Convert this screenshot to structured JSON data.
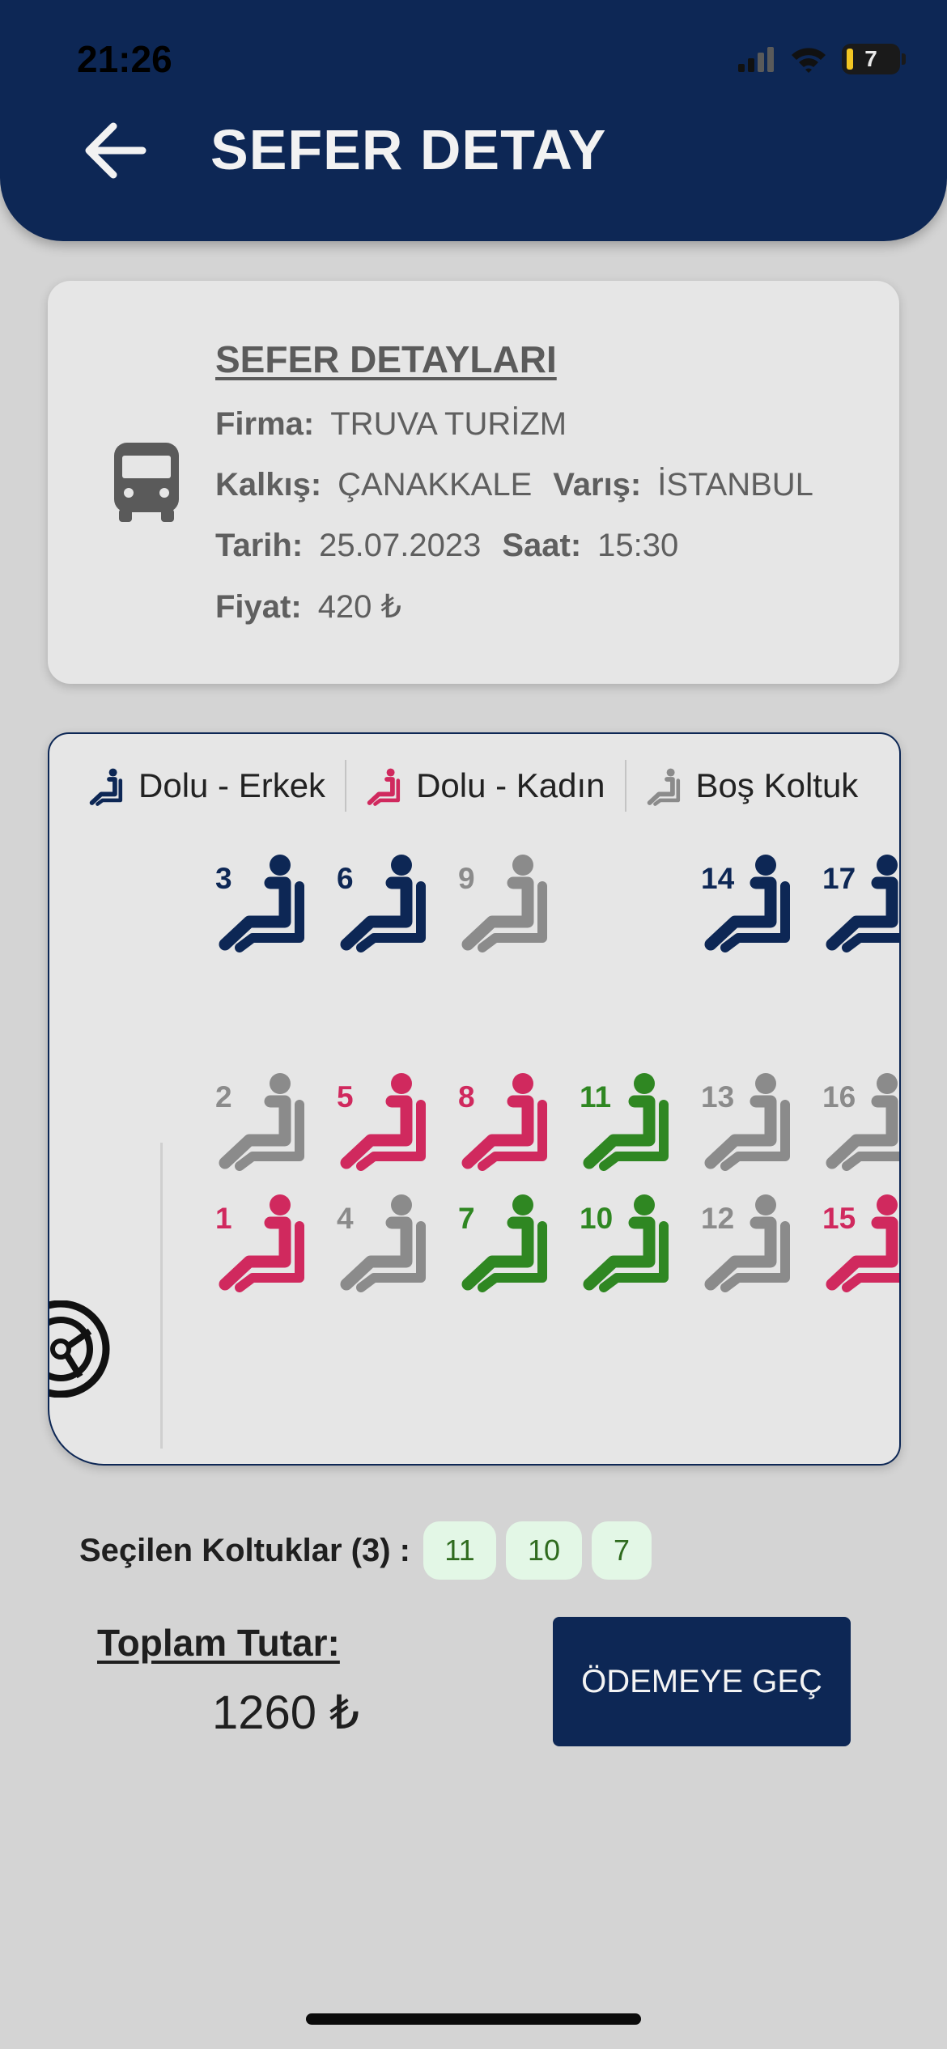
{
  "status_bar": {
    "time": "21:26",
    "battery": "7",
    "icons": [
      "cellular-signal-icon",
      "wifi-icon",
      "battery-icon"
    ]
  },
  "header": {
    "title": "SEFER DETAY",
    "back_icon": "arrow-left-icon"
  },
  "trip": {
    "heading": "SEFER DETAYLARI",
    "icon": "bus-icon",
    "company_label": "Firma:",
    "company": "TRUVA TURİZM",
    "from_label": "Kalkış:",
    "from": "ÇANAKKALE",
    "to_label": "Varış:",
    "to": "İSTANBUL",
    "date_label": "Tarih:",
    "date": "25.07.2023",
    "time_label": "Saat:",
    "time": "15:30",
    "price_label": "Fiyat:",
    "price": "420 ₺"
  },
  "legend": [
    {
      "label": "Dolu - Erkek",
      "color": "#0d2755"
    },
    {
      "label": "Dolu - Kadın",
      "color": "#d0295e"
    },
    {
      "label": "Boş Koltuk",
      "color": "#8b8b8b"
    }
  ],
  "colors": {
    "male": "#0d2755",
    "female": "#d0295e",
    "empty": "#8b8b8b",
    "selected": "#2f8722"
  },
  "seats": [
    {
      "number": "3",
      "status": "male"
    },
    {
      "number": "6",
      "status": "male"
    },
    {
      "number": "9",
      "status": "empty"
    },
    {
      "number": "14",
      "status": "male"
    },
    {
      "number": "17",
      "status": "male"
    },
    {
      "number": "2",
      "status": "empty"
    },
    {
      "number": "5",
      "status": "female"
    },
    {
      "number": "8",
      "status": "female"
    },
    {
      "number": "11",
      "status": "selected"
    },
    {
      "number": "13",
      "status": "empty"
    },
    {
      "number": "16",
      "status": "empty"
    },
    {
      "number": "1",
      "status": "female"
    },
    {
      "number": "4",
      "status": "empty"
    },
    {
      "number": "7",
      "status": "selected"
    },
    {
      "number": "10",
      "status": "selected"
    },
    {
      "number": "12",
      "status": "empty"
    },
    {
      "number": "15",
      "status": "female"
    }
  ],
  "selection": {
    "label": "Seçilen Koltuklar (3) :",
    "seats": [
      "11",
      "10",
      "7"
    ]
  },
  "total": {
    "label": "Toplam Tutar:",
    "value": "1260 ₺"
  },
  "pay_button": {
    "label": "ÖDEMEYE GEÇ"
  }
}
